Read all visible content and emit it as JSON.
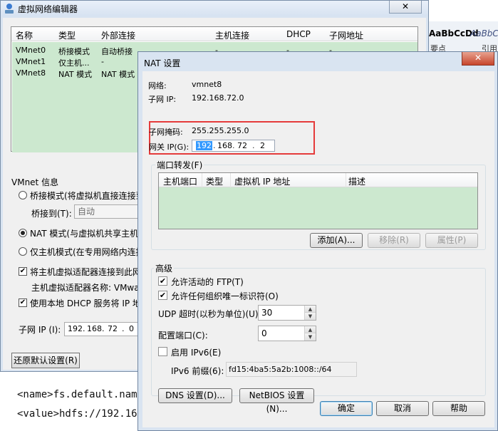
{
  "background_doc": {
    "style_samples": [
      "AaBbCcDd",
      "AaBbC"
    ],
    "style_captions": [
      "要点",
      "引用"
    ],
    "code_lines": [
      "<name>fs.default.nam",
      "<value>hdfs://192.168"
    ]
  },
  "vne": {
    "title": "虚拟网络编辑器",
    "close_label": "✕",
    "list": {
      "headers": [
        "名称",
        "类型",
        "外部连接",
        "主机连接",
        "DHCP",
        "子网地址"
      ],
      "rows": [
        {
          "name": "VMnet0",
          "type": "桥接模式",
          "ext": "自动桥接",
          "host": "-",
          "dhcp": "-",
          "subnet": "-"
        },
        {
          "name": "VMnet1",
          "type": "仅主机...",
          "ext": "-",
          "host": "",
          "dhcp": "",
          "subnet": ""
        },
        {
          "name": "VMnet8",
          "type": "NAT 模式",
          "ext": "NAT 模式",
          "host": "",
          "dhcp": "",
          "subnet": ""
        }
      ]
    },
    "vmnet_info_label": "VMnet 信息",
    "bridge_option": "桥接模式(将虚拟机直接连接到",
    "bridge_to_label": "桥接到(T):",
    "bridge_to_value": "自动",
    "nat_option": "NAT 模式(与虚拟机共享主机的",
    "hostonly_option": "仅主机模式(在专用网络内连接",
    "connect_adapter": "将主机虚拟适配器连接到此网",
    "adapter_name": "主机虚拟适配器名称: VMwar",
    "use_dhcp": "使用本地 DHCP 服务将 IP 地址",
    "subnet_ip_label": "子网 IP (I):",
    "subnet_ip": [
      "192",
      "168",
      "72",
      "0"
    ],
    "restore_button": "还原默认设置(R)"
  },
  "nat": {
    "title": "NAT 设置",
    "close_label": "✕",
    "network_label": "网络:",
    "network_value": "vmnet8",
    "subnet_ip_label": "子网 IP:",
    "subnet_ip_value": "192.168.72.0",
    "subnet_mask_label": "子网掩码:",
    "subnet_mask_value": "255.255.255.0",
    "gateway_label": "网关 IP(G):",
    "gateway_ip": [
      "192",
      "168",
      "72",
      "2"
    ],
    "port_forwarding": {
      "title": "端口转发(F)",
      "headers": [
        "主机端口",
        "类型",
        "虚拟机 IP 地址",
        "描述"
      ],
      "add_button": "添加(A)...",
      "remove_button": "移除(R)",
      "properties_button": "属性(P)"
    },
    "advanced": {
      "title": "高级",
      "allow_ftp": "允许活动的 FTP(T)",
      "allow_any_oui": "允许任何组织唯一标识符(O)",
      "udp_timeout_label": "UDP 超时(以秒为单位)(U):",
      "udp_timeout_value": "30",
      "config_port_label": "配置端口(C):",
      "config_port_value": "0",
      "enable_ipv6": "启用 IPv6(E)",
      "ipv6_prefix_label": "IPv6 前缀(6):",
      "ipv6_prefix_value": "fd15:4ba5:5a2b:1008::/64",
      "dns_button": "DNS 设置(D)...",
      "netbios_button": "NetBIOS 设置(N)..."
    },
    "ok_button": "确定",
    "cancel_button": "取消",
    "help_button": "帮助"
  }
}
